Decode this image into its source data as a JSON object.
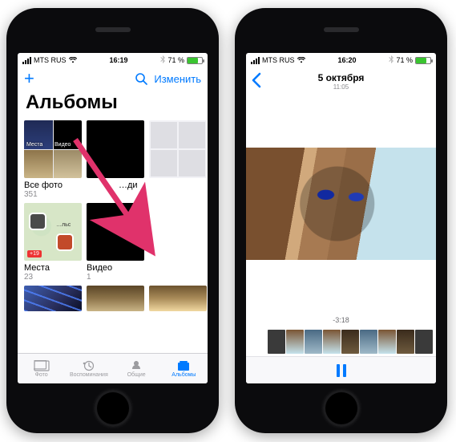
{
  "left": {
    "status": {
      "carrier": "MTS RUS",
      "time": "16:19",
      "battery_pct": "71 %"
    },
    "nav": {
      "edit": "Изменить"
    },
    "title": "Альбомы",
    "albums": [
      {
        "name": "Все фото",
        "count": "351",
        "overlay_a": "Места",
        "overlay_b": "Видео"
      },
      {
        "name": "…ди",
        "count": ""
      },
      {
        "name": "",
        "count": ""
      },
      {
        "name": "Места",
        "count": "23",
        "overlay": "…льс"
      },
      {
        "name": "Видео",
        "count": "1"
      }
    ],
    "tabs": {
      "photos": "Фото",
      "memories": "Воспоминания",
      "shared": "Общие",
      "albums": "Альбомы"
    }
  },
  "right": {
    "status": {
      "carrier": "MTS RUS",
      "time": "16:20",
      "battery_pct": "71 %"
    },
    "header": {
      "date": "5 октября",
      "time": "11:05"
    },
    "remaining": "-3:18"
  }
}
